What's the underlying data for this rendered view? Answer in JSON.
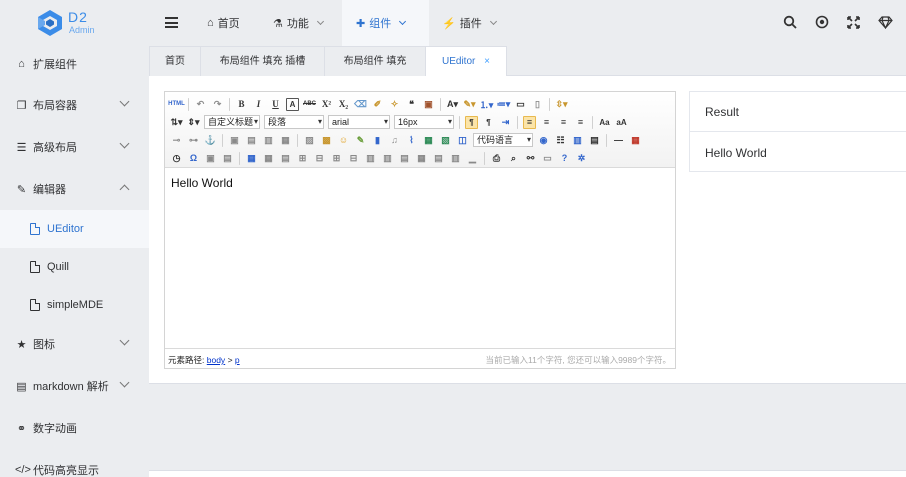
{
  "brand": {
    "title": "D2",
    "subtitle": "Admin",
    "accent": "#3b8ce8"
  },
  "sidebar": {
    "items": [
      {
        "label": "扩展组件",
        "icon": "home-icon"
      },
      {
        "label": "布局容器",
        "icon": "window-restore-icon",
        "expandable": true
      },
      {
        "label": "高级布局",
        "icon": "list-icon",
        "expandable": true
      },
      {
        "label": "编辑器",
        "icon": "edit-icon",
        "expandable": true,
        "expanded": true
      },
      {
        "label": "图标",
        "icon": "star-icon",
        "expandable": true
      },
      {
        "label": "markdown 解析",
        "icon": "file-text-icon",
        "expandable": true
      },
      {
        "label": "数字动画",
        "icon": "motorcycle-icon"
      },
      {
        "label": "代码高亮显示",
        "icon": "code-icon"
      }
    ],
    "sub_items": [
      {
        "label": "UEditor",
        "active": true
      },
      {
        "label": "Quill"
      },
      {
        "label": "simpleMDE"
      }
    ]
  },
  "header": {
    "menus": [
      {
        "label": "首页",
        "icon": "home-icon"
      },
      {
        "label": "功能",
        "icon": "flask-icon",
        "dropdown": true
      },
      {
        "label": "组件",
        "icon": "puzzle-icon",
        "dropdown": true,
        "active": true
      },
      {
        "label": "插件",
        "icon": "plug-icon",
        "dropdown": true
      }
    ],
    "right_icons": [
      "search-icon",
      "target-icon",
      "fullscreen-icon",
      "diamond-icon"
    ]
  },
  "tabs": [
    {
      "label": "首页"
    },
    {
      "label": "布局组件 填充 插槽"
    },
    {
      "label": "布局组件 填充"
    },
    {
      "label": "UEditor",
      "active": true,
      "closable": true
    }
  ],
  "editor": {
    "heading_select": "自定义标题",
    "paragraph_select": "段落",
    "font_select": "arial",
    "size_select": "16px",
    "code_select": "代码语言",
    "content": "Hello World",
    "path_label": "元素路径:",
    "path_body": "body",
    "path_sep": ">",
    "path_p": "p",
    "word_count": "当前已输入11个字符, 您还可以输入9989个字符。"
  },
  "result": {
    "title": "Result",
    "content": "Hello World"
  },
  "colors": {
    "active_text": "#2f74d0",
    "sidebar_bg": "#ebedf0",
    "panel_bg": "#ffffff"
  }
}
